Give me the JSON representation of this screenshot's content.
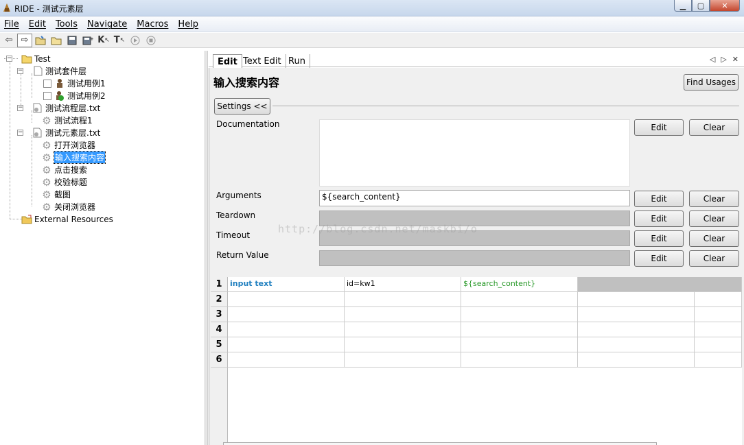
{
  "window": {
    "title": "RIDE - 测试元素层",
    "icon": "ride-app-icon"
  },
  "menu": [
    "File",
    "Edit",
    "Tools",
    "Navigate",
    "Macros",
    "Help"
  ],
  "toolbar": {
    "icons": [
      "back-arrow-icon",
      "forward-arrow-icon",
      "open-folder-icon",
      "open-directory-icon",
      "save-icon",
      "save-all-icon",
      "search-keywords-icon",
      "search-tests-icon",
      "run-icon",
      "stop-icon"
    ],
    "kw_label": "K",
    "t_label": "T"
  },
  "tree": {
    "root": "Test",
    "suite": "测试套件层",
    "case1": "测试用例1",
    "case2": "测试用例2",
    "flow_file": "测试流程层.txt",
    "flow1": "测试流程1",
    "elem_file": "测试元素层.txt",
    "kw1": "打开浏览器",
    "kw2": "输入搜索内容",
    "kw3": "点击搜索",
    "kw4": "校验标题",
    "kw5": "截图",
    "kw6": "关闭浏览器",
    "external": "External Resources"
  },
  "tabs": [
    "Edit",
    "Text Edit",
    "Run"
  ],
  "editor": {
    "title": "输入搜索内容",
    "find_usages": "Find Usages",
    "settings": "Settings <<",
    "fields": {
      "documentation": "Documentation",
      "arguments": "Arguments",
      "arguments_value": "${search_content}",
      "teardown": "Teardown",
      "timeout": "Timeout",
      "return_value": "Return Value"
    },
    "edit_label": "Edit",
    "clear_label": "Clear"
  },
  "grid": {
    "row_numbers": [
      "1",
      "2",
      "3",
      "4",
      "5",
      "6"
    ],
    "row1": [
      "input text",
      "id=kw1",
      "${search_content}"
    ]
  },
  "watermark": "http://blog.csdn.net/maskbi/o"
}
